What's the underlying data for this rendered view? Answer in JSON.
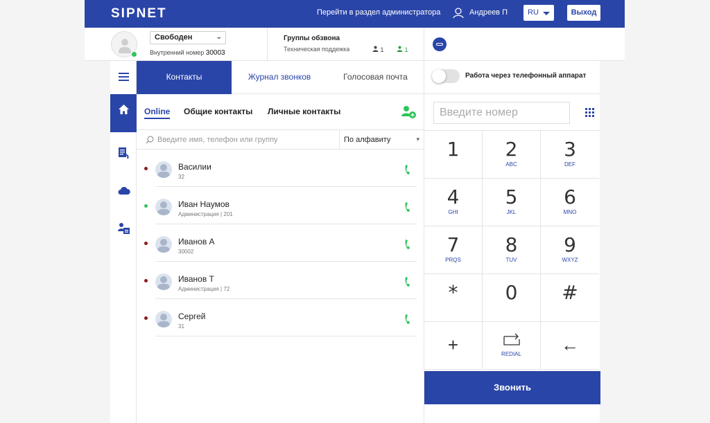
{
  "header": {
    "logo": "SIPNET",
    "admin_link": "Перейти в раздел администратора",
    "user_name": "Андреев П",
    "lang": "RU",
    "logout": "Выход"
  },
  "status": {
    "value": "Свободен",
    "ext_label": "Внутренний номер",
    "ext_number": "30003"
  },
  "groups": {
    "title": "Группы обзвона",
    "subtitle": "Техническая поддежка",
    "count_total": "1",
    "count_online": "1"
  },
  "tabs": [
    "Контакты",
    "Журнал звонков",
    "Голосовая почта"
  ],
  "subtabs": [
    "Online",
    "Общие контакты",
    "Личные контакты"
  ],
  "search": {
    "placeholder": "Введите имя, телефон или группу"
  },
  "sort": {
    "value": "По алфавиту"
  },
  "contacts": [
    {
      "name": "Василии",
      "sub": "32",
      "status_color": "#8b1c1c"
    },
    {
      "name": "Иван Наумов",
      "sub": "Администрация | 201",
      "status_color": "#2fc45a"
    },
    {
      "name": "Иванов А",
      "sub": "30002",
      "status_color": "#8b1c1c"
    },
    {
      "name": "Иванов Т",
      "sub": "Администрация | 72",
      "status_color": "#8b1c1c"
    },
    {
      "name": "Сергей",
      "sub": "31",
      "status_color": "#8b1c1c"
    }
  ],
  "phone_mode": {
    "label": "Работа через телефонный аппарат",
    "enabled": false
  },
  "dialer": {
    "placeholder": "Введите номер",
    "keys": [
      {
        "digit": "1",
        "letters": ""
      },
      {
        "digit": "2",
        "letters": "ABC"
      },
      {
        "digit": "3",
        "letters": "DEF"
      },
      {
        "digit": "4",
        "letters": "GHI"
      },
      {
        "digit": "5",
        "letters": "JKL"
      },
      {
        "digit": "6",
        "letters": "MNO"
      },
      {
        "digit": "7",
        "letters": "PRQS"
      },
      {
        "digit": "8",
        "letters": "TUV"
      },
      {
        "digit": "9",
        "letters": "WXYZ"
      },
      {
        "digit": "*",
        "letters": ""
      },
      {
        "digit": "0",
        "letters": ""
      },
      {
        "digit": "#",
        "letters": ""
      }
    ],
    "plus": "+",
    "redial": "REDIAL",
    "backspace": "←",
    "call": "Звонить"
  },
  "colors": {
    "brand": "#2a45a8",
    "online": "#2fc45a",
    "offline": "#8b1c1c",
    "call": "#2fc45a"
  }
}
